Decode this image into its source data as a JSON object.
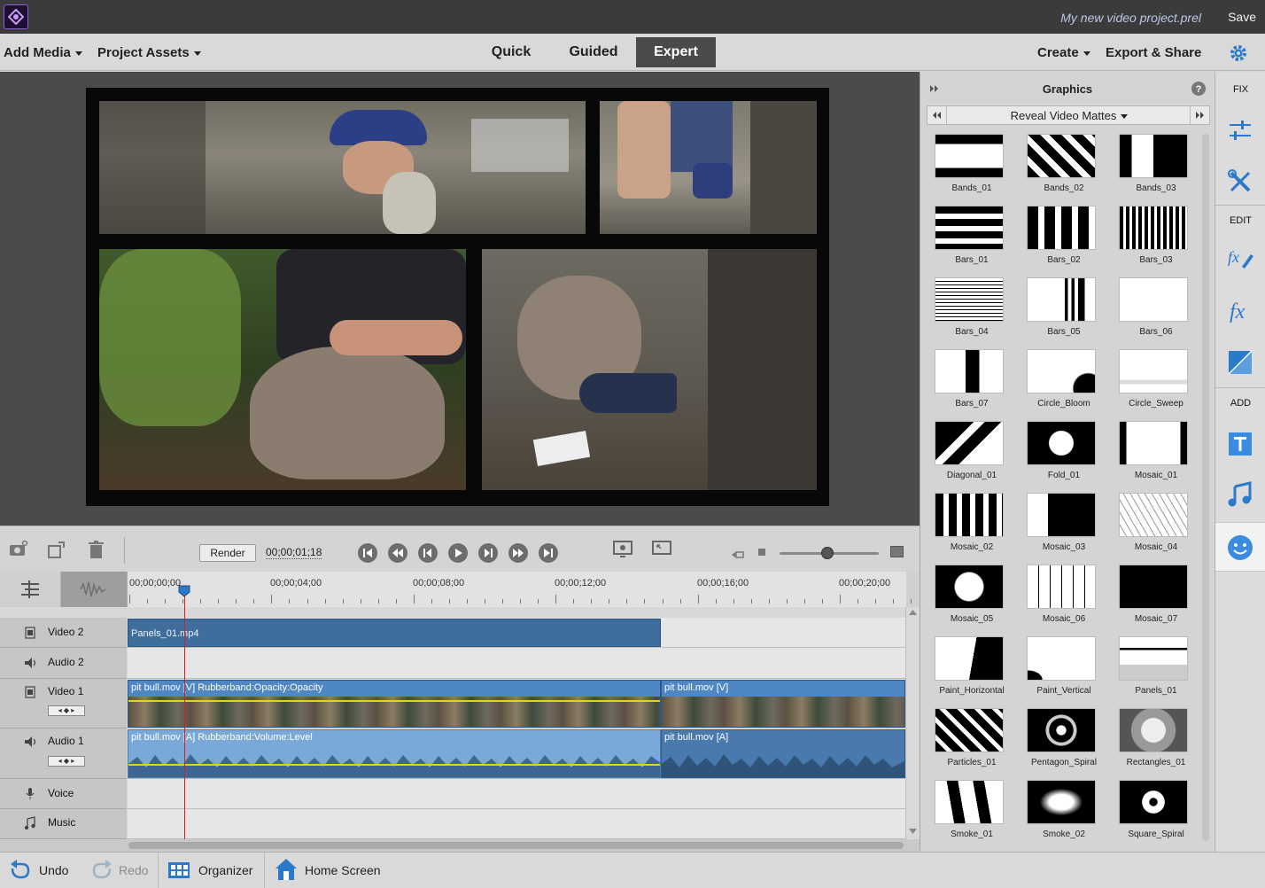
{
  "titlebar": {
    "project_name": "My new video project.prel",
    "save_label": "Save"
  },
  "menubar": {
    "add_media": "Add Media",
    "project_assets": "Project Assets",
    "tabs": [
      {
        "label": "Quick",
        "active": false
      },
      {
        "label": "Guided",
        "active": false
      },
      {
        "label": "Expert",
        "active": true
      }
    ],
    "create": "Create",
    "export_share": "Export & Share"
  },
  "timeline_toolbar": {
    "render_label": "Render",
    "timecode": "00;00;01;18",
    "zoom_level": 0.45
  },
  "ruler": {
    "ticks": [
      "00;00;00;00",
      "00;00;04;00",
      "00;00;08;00",
      "00;00;12;00",
      "00;00;16;00",
      "00;00;20;00"
    ]
  },
  "tracks": [
    {
      "name": "Video 2",
      "type": "video",
      "expanded": false
    },
    {
      "name": "Audio 2",
      "type": "audio",
      "expanded": false
    },
    {
      "name": "Video 1",
      "type": "video",
      "expanded": true
    },
    {
      "name": "Audio 1",
      "type": "audio",
      "expanded": true
    },
    {
      "name": "Voice",
      "type": "mic",
      "expanded": false
    },
    {
      "name": "Music",
      "type": "music",
      "expanded": false
    }
  ],
  "clips": {
    "video2": "Panels_01.mp4",
    "video1_a": "pit bull.mov [V] Rubberband:Opacity:Opacity",
    "video1_b": "pit bull.mov [V]",
    "audio1_a": "pit bull.mov [A] Rubberband:Volume:Level",
    "audio1_b": "pit bull.mov [A]"
  },
  "graphics_panel": {
    "title": "Graphics",
    "category": "Reveal Video Mattes",
    "items": [
      "Bands_01",
      "Bands_02",
      "Bands_03",
      "Bars_01",
      "Bars_02",
      "Bars_03",
      "Bars_04",
      "Bars_05",
      "Bars_06",
      "Bars_07",
      "Circle_Bloom",
      "Circle_Sweep",
      "Diagonal_01",
      "Fold_01",
      "Mosaic_01",
      "Mosaic_02",
      "Mosaic_03",
      "Mosaic_04",
      "Mosaic_05",
      "Mosaic_06",
      "Mosaic_07",
      "Paint_Horizontal",
      "Paint_Vertical",
      "Panels_01",
      "Particles_01",
      "Pentagon_Spiral",
      "Rectangles_01",
      "Smoke_01",
      "Smoke_02",
      "Square_Spiral"
    ]
  },
  "tool_rail": {
    "fix": "FIX",
    "edit": "EDIT",
    "add": "ADD"
  },
  "bottombar": {
    "undo": "Undo",
    "redo": "Redo",
    "organizer": "Organizer",
    "home": "Home Screen"
  },
  "colors": {
    "accent": "#2a7ac9",
    "clip_blue": "#3f6e9d",
    "audio_blue": "#7aa8d8",
    "playhead": "#d81e1e",
    "titlebar": "#3b3b3b"
  }
}
